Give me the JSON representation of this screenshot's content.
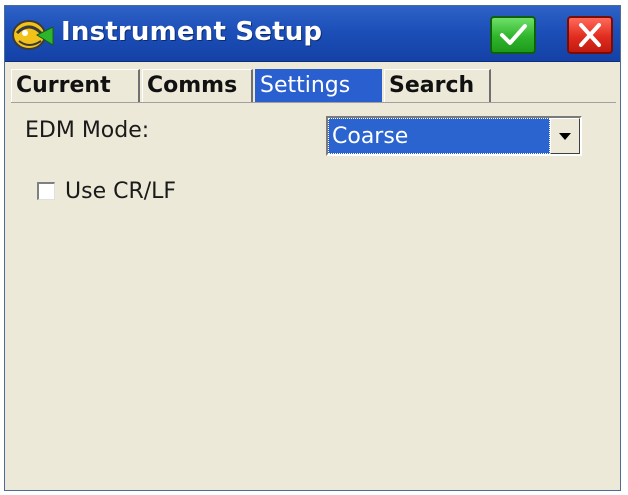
{
  "window": {
    "title": "Instrument Setup",
    "icons": {
      "app": "instrument-icon",
      "ok": "checkmark-icon",
      "close": "x-icon"
    }
  },
  "tabs": [
    {
      "label": "Current",
      "active": false
    },
    {
      "label": "Comms",
      "active": false
    },
    {
      "label": "Settings",
      "active": true
    },
    {
      "label": "Search",
      "active": false
    }
  ],
  "settings": {
    "edm_mode_label": "EDM Mode:",
    "edm_mode_value": "Coarse",
    "use_crlf_label": "Use CR/LF",
    "use_crlf_checked": false
  },
  "colors": {
    "titlebar": "#1c4fb8",
    "active_tab": "#2a5fd0",
    "ok_button": "#2fb52c",
    "close_button": "#e12d1f",
    "background": "#ece9d8"
  }
}
